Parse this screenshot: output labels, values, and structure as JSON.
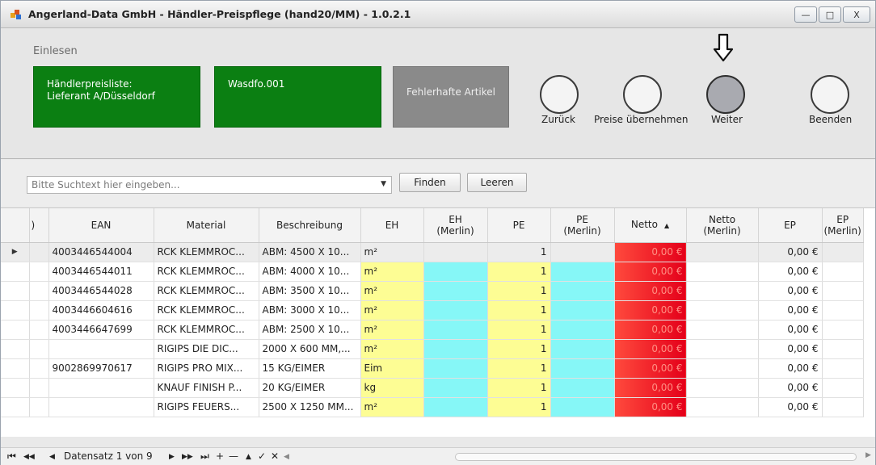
{
  "window": {
    "title": "Angerland-Data GmbH - Händler-Preispflege (hand20/MM) - 1.0.2.1",
    "controls": {
      "minimize": "—",
      "maximize": "□",
      "close": "X"
    }
  },
  "ribbon": {
    "group_label": "Einlesen",
    "tiles": [
      {
        "label": "Händlerpreisliste:\nLieferant A/Düsseldorf",
        "color": "#0b7f12"
      },
      {
        "label": "Wasdfo.001",
        "color": "#0b7f12"
      },
      {
        "label": "Fehlerhafte Artikel",
        "color": "#8a8a8a"
      }
    ],
    "buttons": [
      {
        "label": "Zurück"
      },
      {
        "label": "Preise übernehmen"
      },
      {
        "label": "Weiter",
        "active": true
      },
      {
        "label": "Beenden"
      }
    ],
    "pointer_icon": "down-arrow-icon"
  },
  "search": {
    "placeholder": "Bitte Suchtext hier eingeben...",
    "value": "",
    "find_label": "Finden",
    "clear_label": "Leeren"
  },
  "table": {
    "columns": {
      "prev": ")",
      "ean": "EAN",
      "material": "Material",
      "beschreibung": "Beschreibung",
      "eh": "EH",
      "eh_merlin": "EH\n(Merlin)",
      "pe": "PE",
      "pe_merlin": "PE\n(Merlin)",
      "netto": "Netto",
      "netto_merlin": "Netto\n(Merlin)",
      "ep": "EP",
      "ep_merlin": "EP\n(Merlin)"
    },
    "sort_indicator": "▲",
    "row_pointer": "▶",
    "rows": [
      {
        "ean": "4003446544004",
        "material": "RCK KLEMMROC...",
        "beschreibung": "ABM: 4500 X 10...",
        "eh": "m²",
        "pe": "1",
        "netto": "0,00 €",
        "ep": "0,00 €"
      },
      {
        "ean": "4003446544011",
        "material": "RCK KLEMMROC...",
        "beschreibung": "ABM: 4000 X 10...",
        "eh": "m²",
        "pe": "1",
        "netto": "0,00 €",
        "ep": "0,00 €"
      },
      {
        "ean": "4003446544028",
        "material": "RCK KLEMMROC...",
        "beschreibung": "ABM: 3500 X 10...",
        "eh": "m²",
        "pe": "1",
        "netto": "0,00 €",
        "ep": "0,00 €"
      },
      {
        "ean": "4003446604616",
        "material": "RCK KLEMMROC...",
        "beschreibung": "ABM: 3000 X 10...",
        "eh": "m²",
        "pe": "1",
        "netto": "0,00 €",
        "ep": "0,00 €"
      },
      {
        "ean": "4003446647699",
        "material": "RCK KLEMMROC...",
        "beschreibung": "ABM: 2500 X 10...",
        "eh": "m²",
        "pe": "1",
        "netto": "0,00 €",
        "ep": "0,00 €"
      },
      {
        "ean": "",
        "material": "RIGIPS DIE DIC...",
        "beschreibung": "2000 X  600 MM,...",
        "eh": "m²",
        "pe": "1",
        "netto": "0,00 €",
        "ep": "0,00 €"
      },
      {
        "ean": "9002869970617",
        "material": "RIGIPS PRO MIX...",
        "beschreibung": "15 KG/EIMER",
        "eh": "Eim",
        "pe": "1",
        "netto": "0,00 €",
        "ep": "0,00 €"
      },
      {
        "ean": "",
        "material": "KNAUF FINISH P...",
        "beschreibung": "20 KG/EIMER",
        "eh": "kg",
        "pe": "1",
        "netto": "0,00 €",
        "ep": "0,00 €"
      },
      {
        "ean": "",
        "material": "RIGIPS FEUERS...",
        "beschreibung": "2500 X 1250 MM...",
        "eh": "m²",
        "pe": "1",
        "netto": "0,00 €",
        "ep": "0,00 €"
      }
    ]
  },
  "navigator": {
    "first": "⏮",
    "prev_page": "◀◀",
    "prev": "◀",
    "record_text": "Datensatz 1 von 9",
    "next": "▶",
    "next_page": "▶▶",
    "last": "⏭",
    "add": "+",
    "remove": "—",
    "up": "▲",
    "confirm": "✓",
    "cancel": "✕",
    "more": "◀"
  },
  "colors": {
    "tile_green": "#0b7f12",
    "tile_gray": "#8a8a8a",
    "cell_yellow": "#fdfd94",
    "cell_cyan": "#86f7f7",
    "cell_red": "#ff2a1f"
  }
}
